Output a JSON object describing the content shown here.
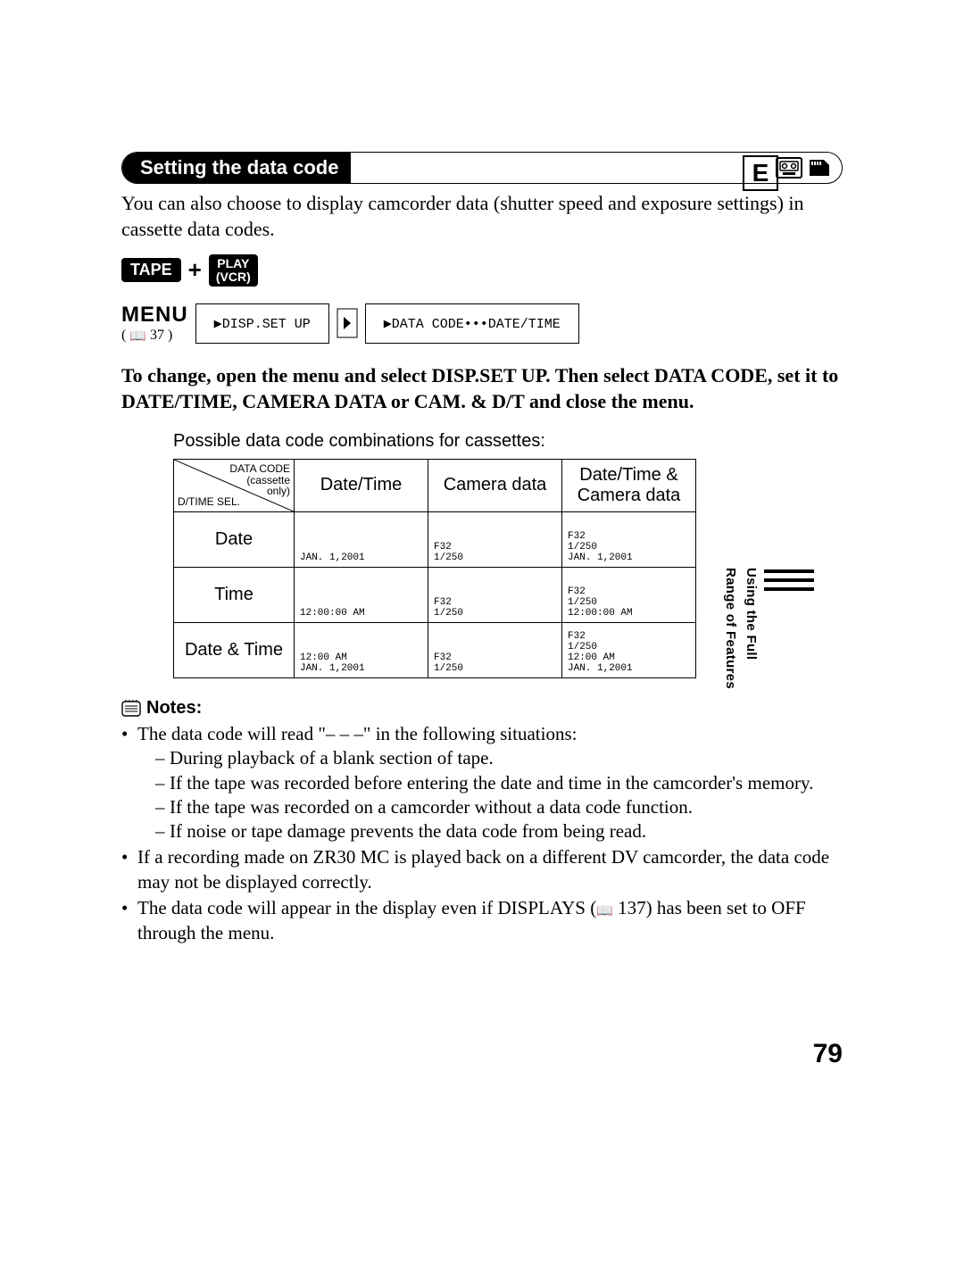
{
  "section": {
    "title": "Setting the data code"
  },
  "badge": "E",
  "intro": "You can also choose to display camcorder data (shutter speed and exposure settings) in cassette data codes.",
  "mode": {
    "tape": "TAPE",
    "plus": "+",
    "play1": "PLAY",
    "play2": "(VCR)"
  },
  "menu": {
    "label": "MENU",
    "ref": "37",
    "step1": "▶DISP.SET UP",
    "step2": "▶DATA CODE•••DATE/TIME"
  },
  "instruction": "To change, open the menu and select DISP.SET UP. Then select DATA CODE, set it to DATE/TIME, CAMERA DATA or CAM. & D/T and close the menu.",
  "table": {
    "caption": "Possible data code combinations for cassettes:",
    "corner_top": "DATA CODE\n(cassette\nonly)",
    "corner_bottom": "D/TIME SEL.",
    "cols": [
      "Date/Time",
      "Camera data",
      "Date/Time &\nCamera data"
    ],
    "rows": [
      {
        "head": "Date",
        "cells": [
          "JAN. 1,2001",
          "F32\n1/250",
          "F32\n1/250\nJAN. 1,2001"
        ]
      },
      {
        "head": "Time",
        "cells": [
          "12:00:00 AM",
          "F32\n1/250",
          "F32\n1/250\n12:00:00 AM"
        ]
      },
      {
        "head": "Date & Time",
        "cells": [
          "12:00 AM\nJAN. 1,2001",
          "F32\n1/250",
          "F32\n1/250\n12:00 AM\nJAN. 1,2001"
        ]
      }
    ]
  },
  "notes": {
    "heading": "Notes:",
    "items": [
      {
        "text": "The data code will read \"– – –\" in the following situations:",
        "sub": [
          "During playback of a blank section of tape.",
          "If the tape was recorded before entering the date and time in the camcorder's memory.",
          "If the tape was recorded on a camcorder without a data code function.",
          "If noise or tape damage prevents the data code from being read."
        ]
      },
      {
        "text": "If a recording made on ZR30 MC is played back on a different DV camcorder, the data code may not be displayed correctly."
      },
      {
        "text_pre": "The data code will appear in the display even if DISPLAYS (",
        "ref": "137",
        "text_post": ") has been set to OFF through the menu."
      }
    ]
  },
  "sidebar": {
    "l1": "Using the Full",
    "l2": "Range of Features"
  },
  "page": "79"
}
